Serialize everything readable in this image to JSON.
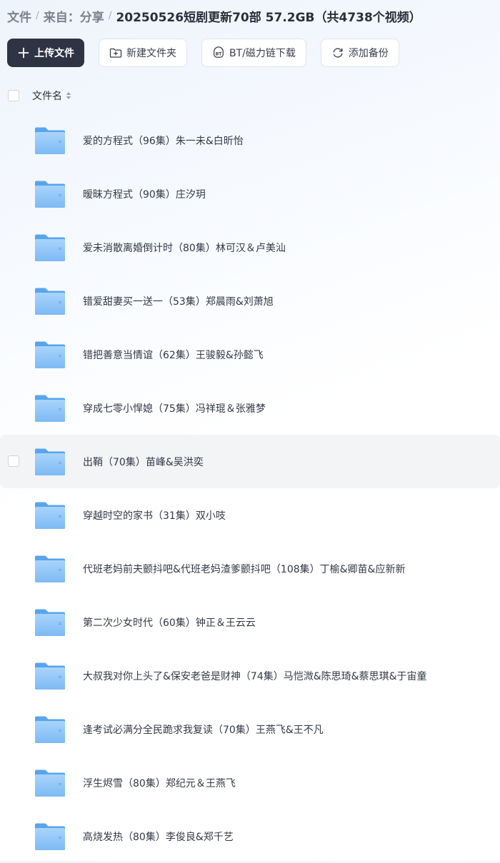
{
  "breadcrumb": {
    "root": "文件",
    "from": "来自：分享",
    "current": "20250526短剧更新70部 57.2GB（共4738个视频）"
  },
  "toolbar": {
    "upload": "上传文件",
    "new_folder": "新建文件夹",
    "bt_download": "BT/磁力链下载",
    "add_backup": "添加备份"
  },
  "list_header": {
    "name_label": "文件名"
  },
  "files": [
    {
      "name": "爱的方程式（96集）朱一未&白昕怡"
    },
    {
      "name": "暧昧方程式（90集）庄汐玥"
    },
    {
      "name": "爱未消散离婚倒计时（80集）林可汉＆卢美汕"
    },
    {
      "name": "错爱甜妻买一送一（53集）郑晨雨&刘萧旭"
    },
    {
      "name": "错把善意当情谊（62集）王骏毅&孙懿飞"
    },
    {
      "name": "穿成七零小悍媳（75集）冯祥琨＆张雅梦"
    },
    {
      "name": "出鞘（70集）苗峰&吴洪奕"
    },
    {
      "name": "穿越时空的家书（31集）双小吱"
    },
    {
      "name": "代班老妈前夫颤抖吧&代班老妈渣爹颤抖吧（108集）丁榆&卿苗&应新新"
    },
    {
      "name": "第二次少女时代（60集）钟正＆王云云"
    },
    {
      "name": "大叔我对你上头了&保安老爸是财神（74集）马恺溦&陈思琦&蔡思琪&于宙童"
    },
    {
      "name": "逢考试必满分全民跪求我复读（70集）王燕飞&王不凡"
    },
    {
      "name": "浮生烬雪（80集）郑纪元＆王燕飞"
    },
    {
      "name": "高烧发热（80集）李俊良&郑千艺"
    }
  ]
}
